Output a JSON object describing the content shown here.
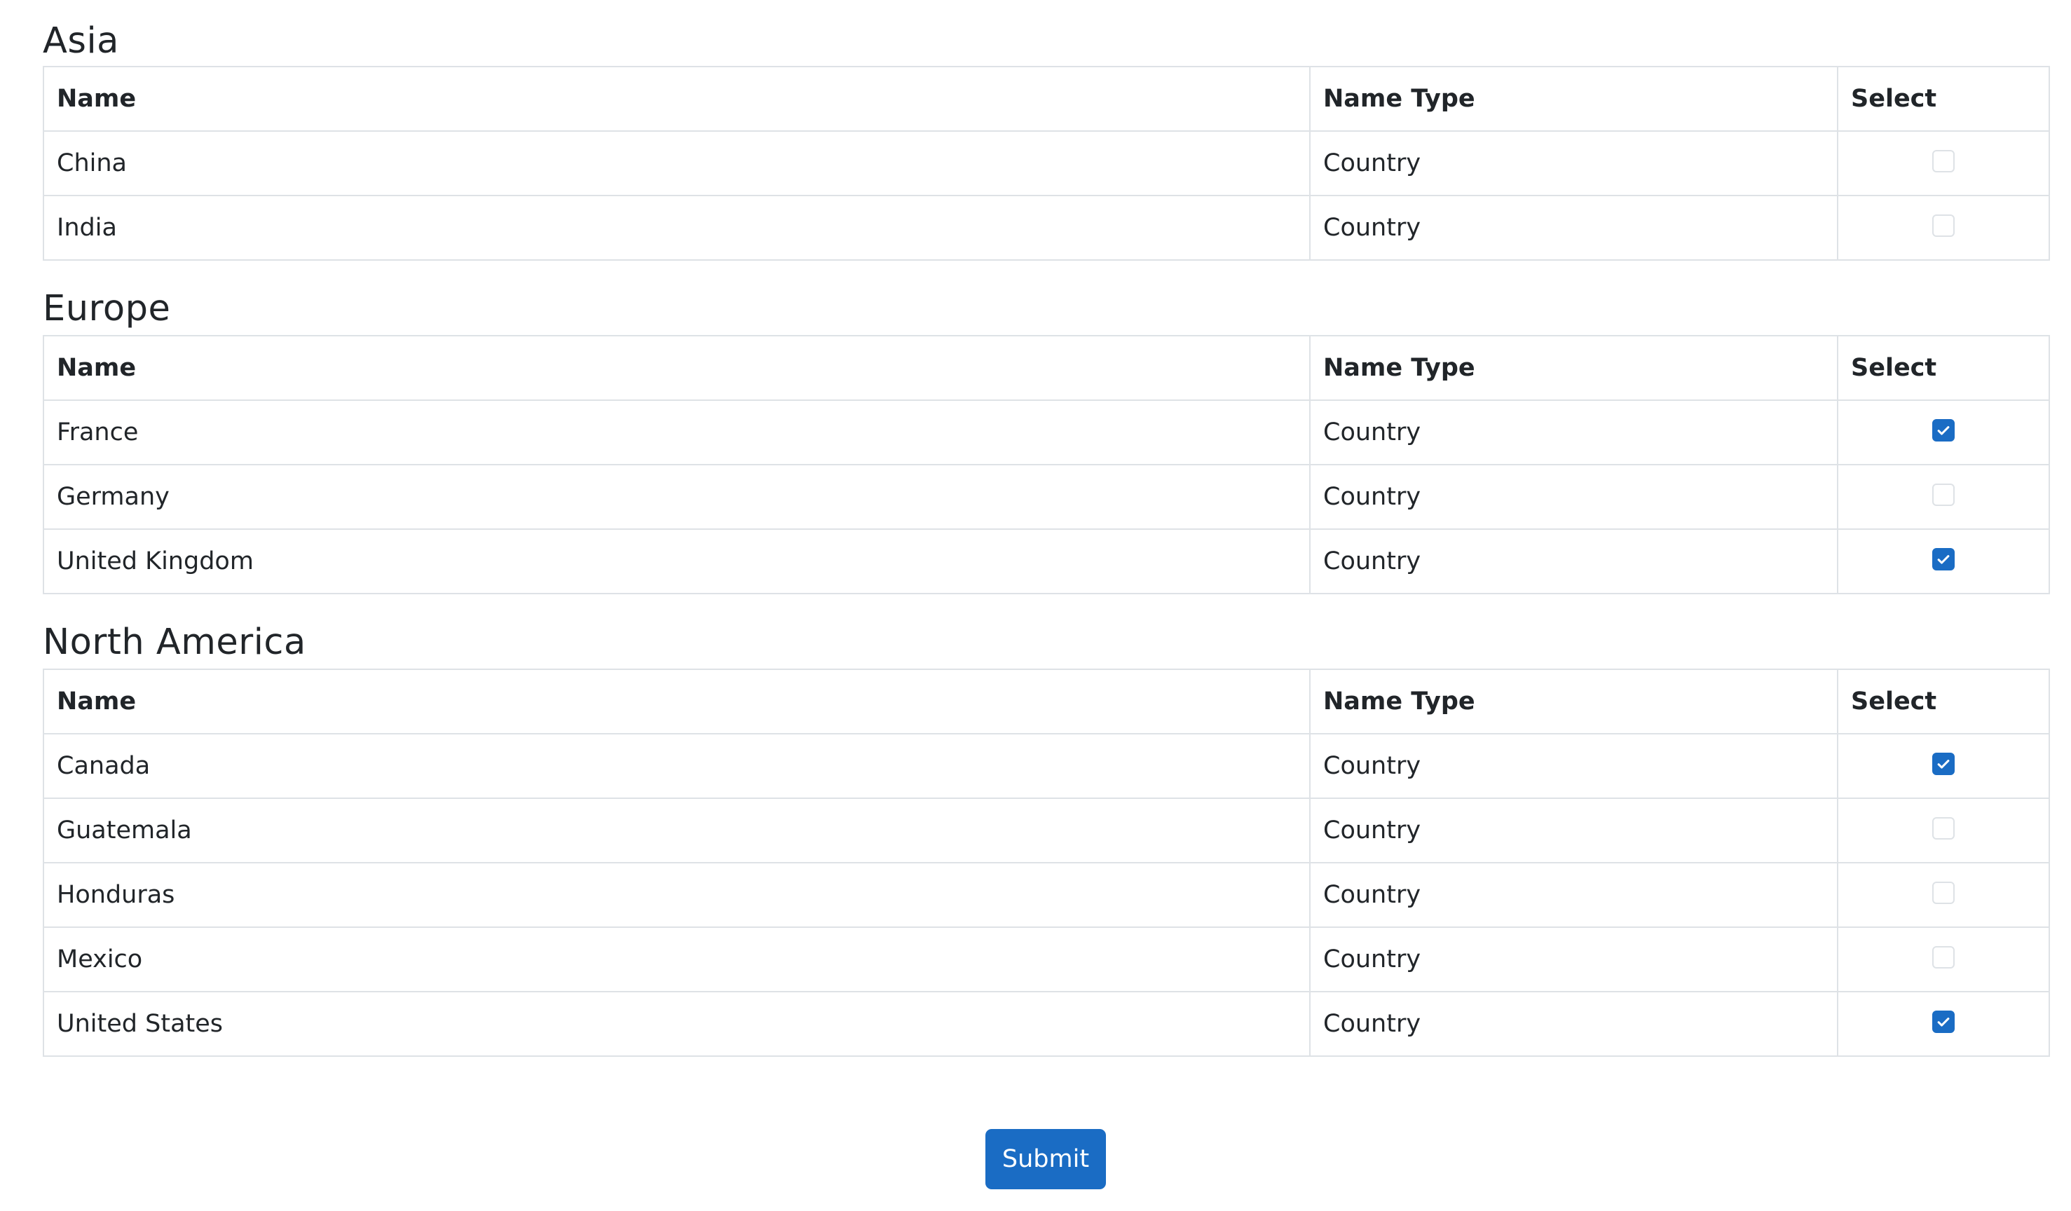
{
  "columns": {
    "name": "Name",
    "name_type": "Name Type",
    "select": "Select"
  },
  "regions": [
    {
      "title": "Asia",
      "rows": [
        {
          "name": "China",
          "name_type": "Country",
          "selected": false
        },
        {
          "name": "India",
          "name_type": "Country",
          "selected": false
        }
      ]
    },
    {
      "title": "Europe",
      "rows": [
        {
          "name": "France",
          "name_type": "Country",
          "selected": true
        },
        {
          "name": "Germany",
          "name_type": "Country",
          "selected": false
        },
        {
          "name": "United Kingdom",
          "name_type": "Country",
          "selected": true
        }
      ]
    },
    {
      "title": "North America",
      "rows": [
        {
          "name": "Canada",
          "name_type": "Country",
          "selected": true
        },
        {
          "name": "Guatemala",
          "name_type": "Country",
          "selected": false
        },
        {
          "name": "Honduras",
          "name_type": "Country",
          "selected": false
        },
        {
          "name": "Mexico",
          "name_type": "Country",
          "selected": false
        },
        {
          "name": "United States",
          "name_type": "Country",
          "selected": true
        }
      ]
    }
  ],
  "submit_label": "Submit",
  "colors": {
    "accent": "#1a6cc4",
    "border": "#dee2e6",
    "text": "#212529"
  },
  "icons": {
    "checkbox_checked": "checkmark-icon"
  }
}
